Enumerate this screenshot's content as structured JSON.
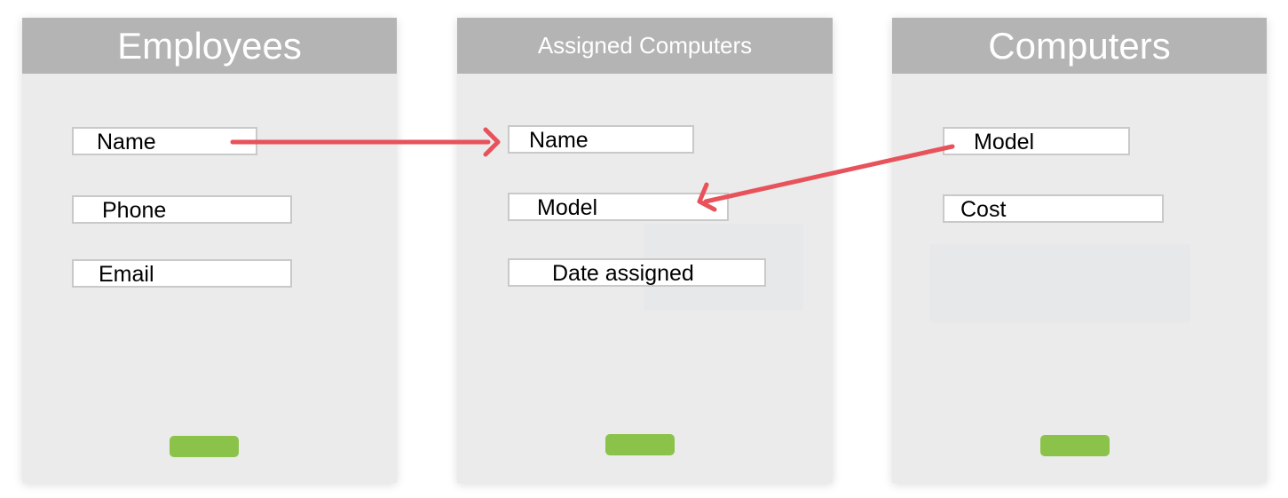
{
  "colors": {
    "panel_bg": "#ebebeb",
    "header_bg": "#b4b4b4",
    "header_text": "#ffffff",
    "field_border": "#c9c9c9",
    "button": "#8bc34a",
    "arrow": "#e8525a"
  },
  "tables": {
    "employees": {
      "title": "Employees",
      "fields": [
        "Name",
        "Phone",
        "Email"
      ]
    },
    "assigned": {
      "title": "Assigned Computers",
      "fields": [
        "Name",
        "Model",
        "Date assigned"
      ]
    },
    "computers": {
      "title": "Computers",
      "fields": [
        "Model",
        "Cost"
      ]
    }
  },
  "relations": [
    {
      "from": "employees.Name",
      "to": "assigned.Name"
    },
    {
      "from": "computers.Model",
      "to": "assigned.Model"
    }
  ]
}
